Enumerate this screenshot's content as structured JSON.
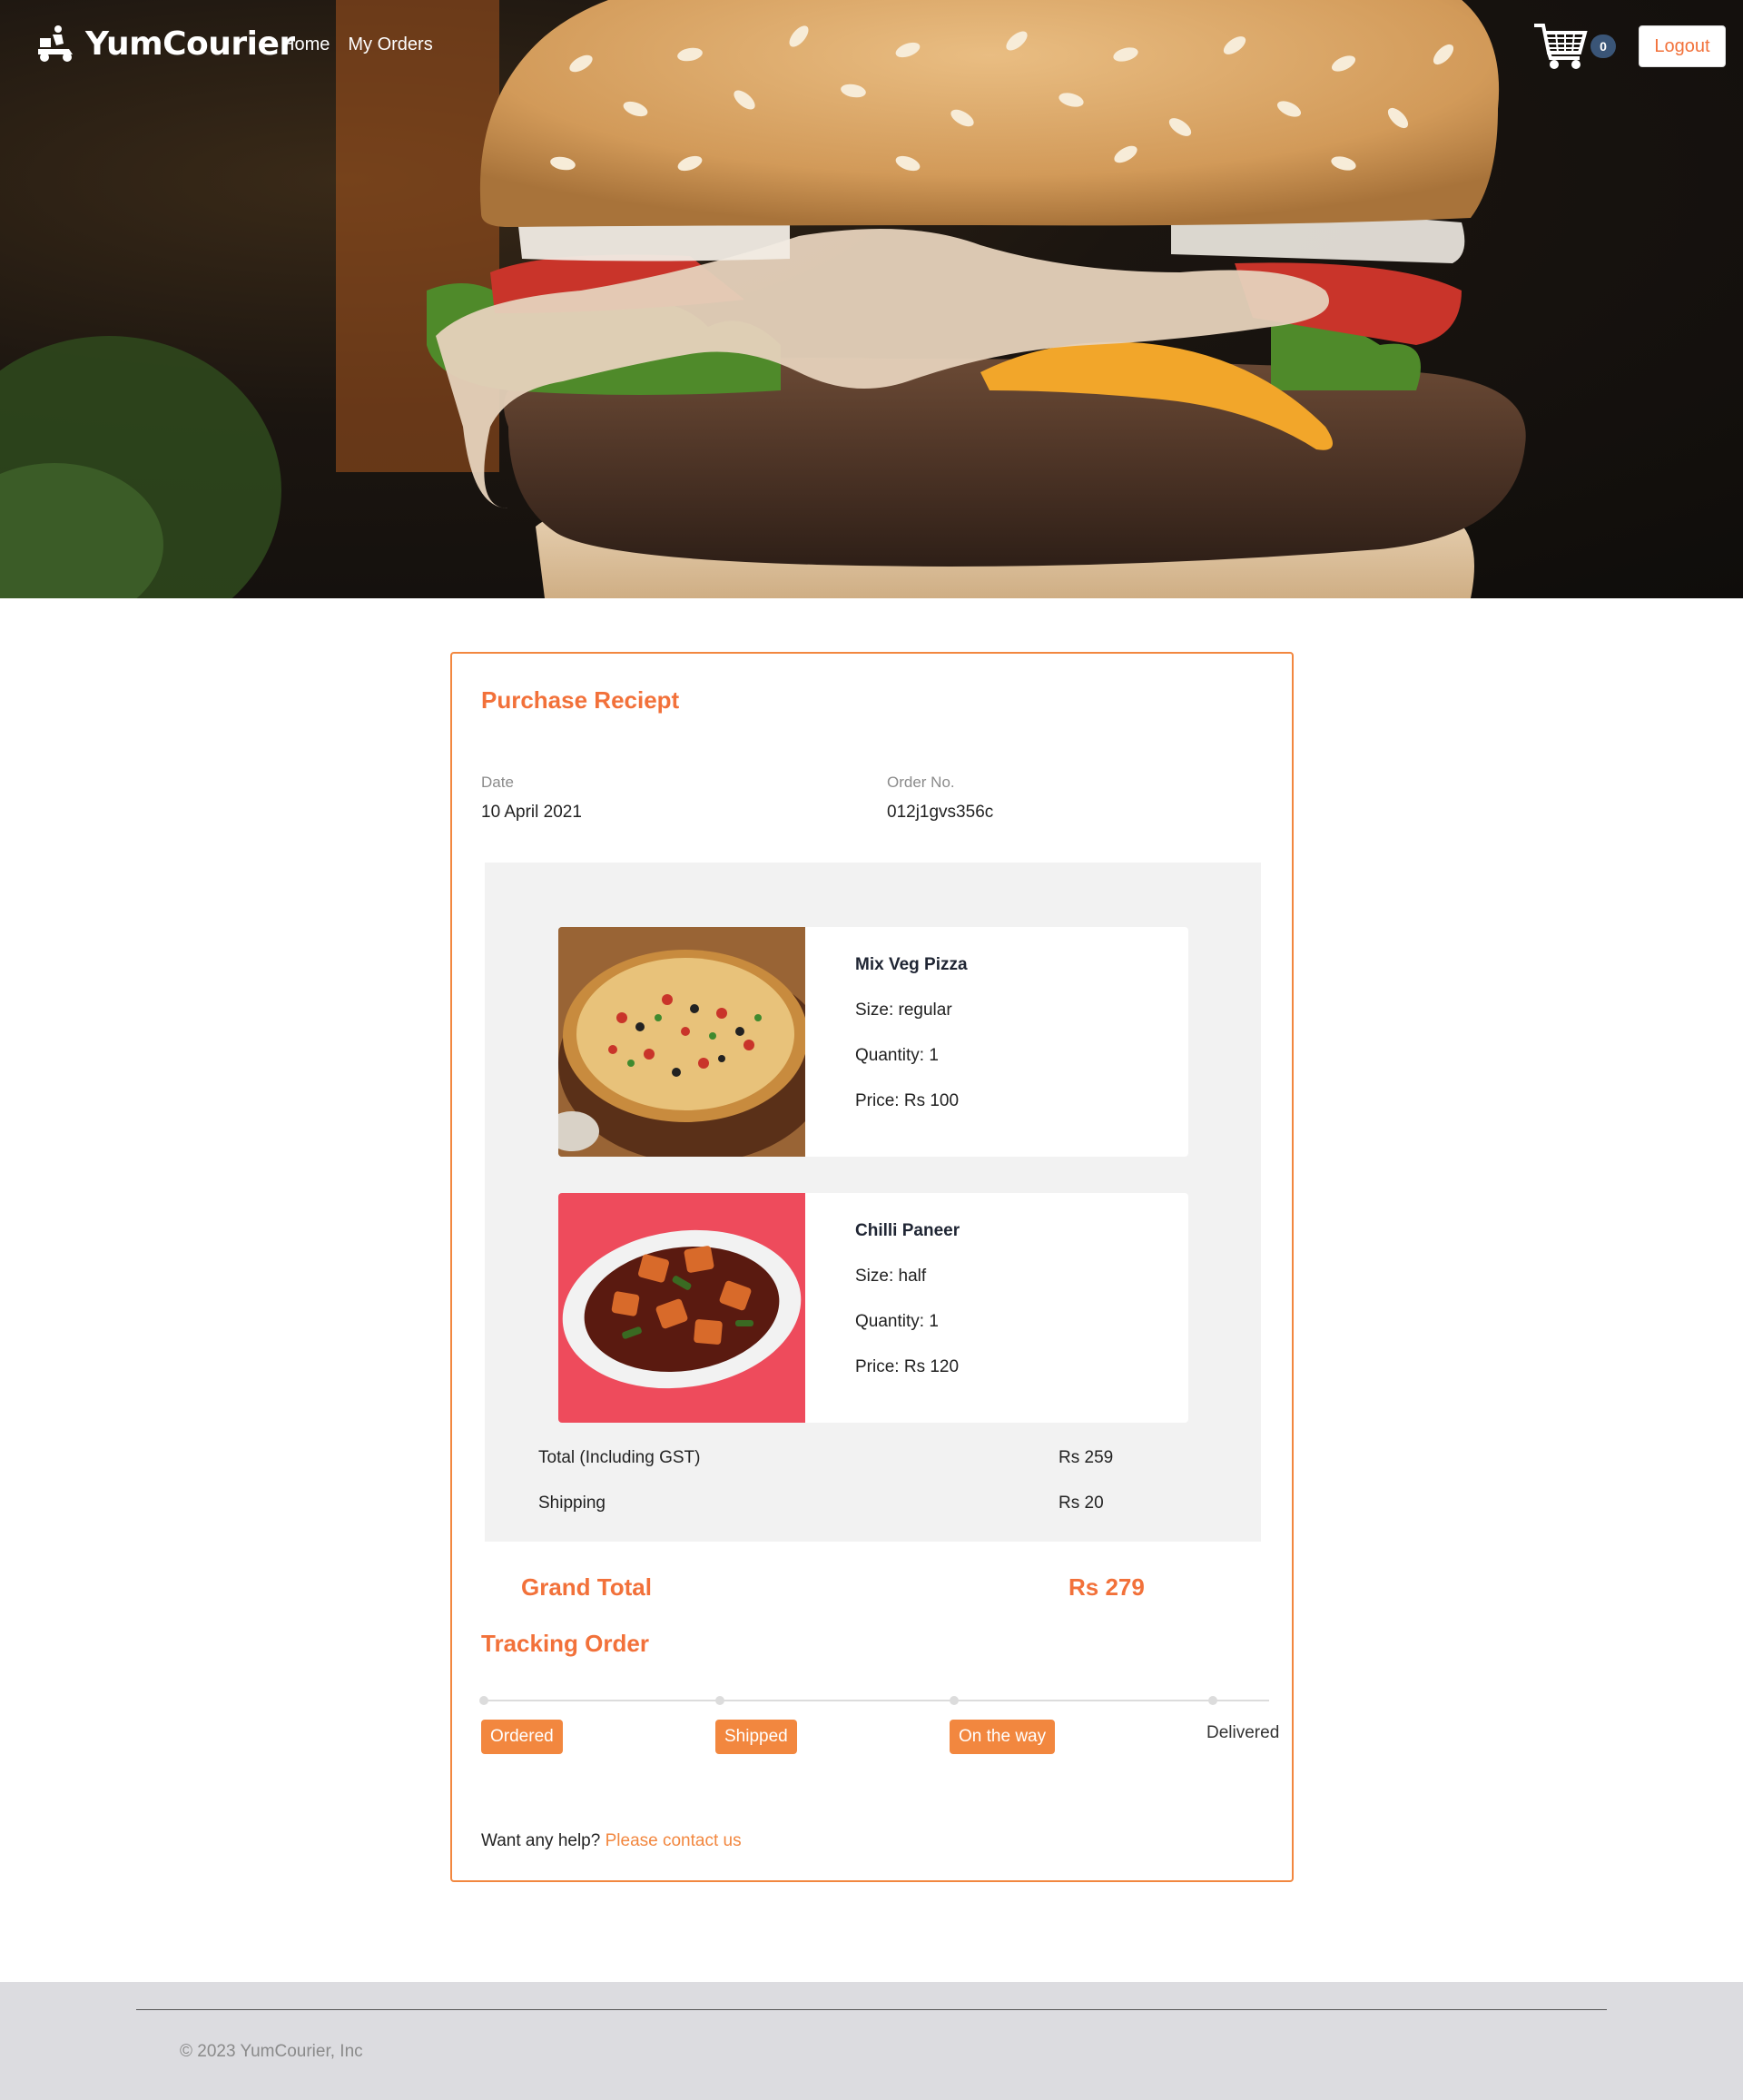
{
  "header": {
    "brand": "YumCourier",
    "nav": [
      {
        "label": "Home"
      },
      {
        "label": "My Orders"
      }
    ],
    "cart_count": "0",
    "logout_label": "Logout"
  },
  "receipt": {
    "title": "Purchase Reciept",
    "date_label": "Date",
    "date_value": "10 April 2021",
    "order_label": "Order No.",
    "order_value": "012j1gvs356c",
    "items": [
      {
        "name": "Mix Veg Pizza",
        "size": "Size: regular",
        "quantity": "Quantity: 1",
        "price": "Price: Rs 100",
        "image": "pizza"
      },
      {
        "name": "Chilli Paneer",
        "size": "Size: half",
        "quantity": "Quantity: 1",
        "price": "Price: Rs 120",
        "image": "chilli-paneer"
      }
    ],
    "total_label": "Total (Including GST)",
    "total_value": "Rs 259",
    "shipping_label": "Shipping",
    "shipping_value": "Rs 20",
    "grand_total_label": "Grand Total",
    "grand_total_value": "Rs 279",
    "tracking_title": "Tracking Order",
    "tracking_steps": [
      {
        "label": "Ordered",
        "done": true
      },
      {
        "label": "Shipped",
        "done": true
      },
      {
        "label": "On the way",
        "done": true
      },
      {
        "label": "Delivered",
        "done": false
      }
    ],
    "help_text": "Want any help?",
    "help_link": "Please contact us"
  },
  "footer": {
    "copyright": "© 2023 YumCourier, Inc"
  },
  "colors": {
    "accent": "#f2873f",
    "accent_text": "#f2713a",
    "badge": "#3a5577",
    "footer_bg": "#dcdce0"
  }
}
